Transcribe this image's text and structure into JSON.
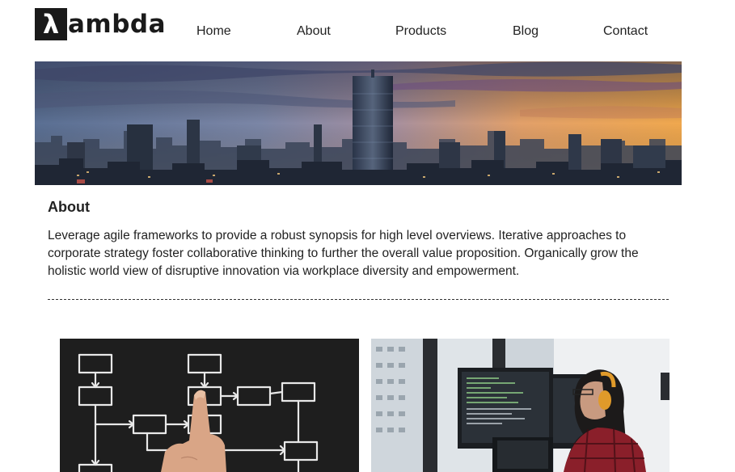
{
  "brand": {
    "logo_glyph": "λ",
    "logo_text": "ambda"
  },
  "nav": {
    "items": [
      {
        "label": "Home"
      },
      {
        "label": "About"
      },
      {
        "label": "Products"
      },
      {
        "label": "Blog"
      },
      {
        "label": "Contact"
      }
    ]
  },
  "about": {
    "title": "About",
    "body": "Leverage agile frameworks to provide a robust synopsis for high level overviews. Iterative approaches to corporate strategy foster collaborative thinking to further the overall value proposition. Organically grow the holistic world view of disruptive innovation via workplace diversity and empowerment."
  },
  "images": {
    "hero": "city-skyline-sunset-image",
    "left_photo": "flowchart-chalkboard-image",
    "right_photo": "developer-at-monitors-image"
  }
}
